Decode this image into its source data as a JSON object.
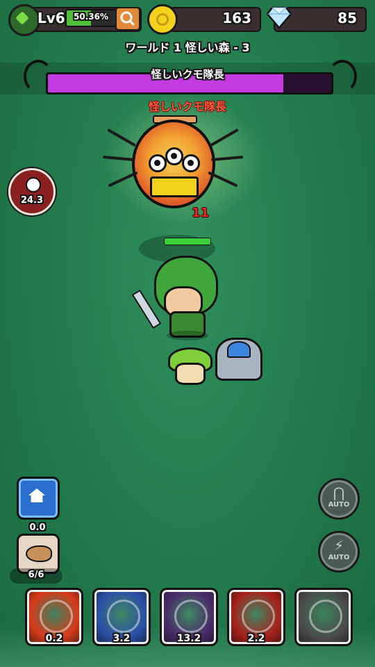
{
  "header": {
    "level_label": "Lv6",
    "xp_percent_label": "50.36%",
    "xp_fraction": 0.5036,
    "coins": "163",
    "gems": "85"
  },
  "stage": {
    "title": "ワールド 1 怪しい森 - 3"
  },
  "boss": {
    "bar_name": "怪しいクモ隊長",
    "overhead_name": "怪しいクモ隊長",
    "hp_fraction": 0.83,
    "damage_popup": "11"
  },
  "timer": {
    "value": "24.3"
  },
  "hero": {
    "hp_fraction": 1.0
  },
  "left_controls": {
    "food_value": "0.0",
    "food_count": "6/6"
  },
  "right_controls": {
    "magnet_auto_label": "AUTO",
    "skill_auto_label": "AUTO"
  },
  "skills": [
    {
      "name": "flame-slash",
      "cooldown": "0.2",
      "color": "#d83a1a"
    },
    {
      "name": "ice-burst",
      "cooldown": "3.2",
      "color": "#2a4fa8"
    },
    {
      "name": "skull-summon",
      "cooldown": "13.2",
      "color": "#4a2a6a"
    },
    {
      "name": "fire-vortex",
      "cooldown": "2.2",
      "color": "#a8201a"
    },
    {
      "name": "locked-slot",
      "cooldown": "",
      "color": "#4a4a4a"
    }
  ],
  "colors": {
    "boss_hp": "#c23ae0",
    "xp_bar": "#4fbf3a",
    "background": "#2a8552"
  }
}
